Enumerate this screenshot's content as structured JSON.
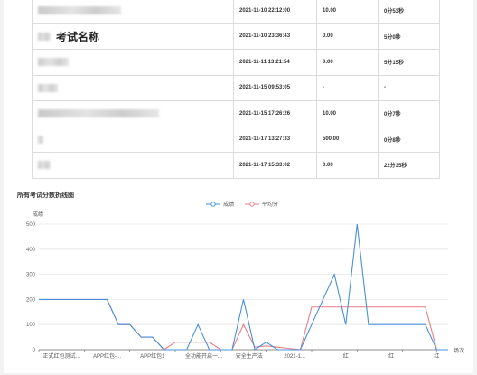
{
  "table": {
    "rows": [
      {
        "name_visible": "",
        "time": "2021-11-10 22:12:00",
        "score": "10.00",
        "duration": "0分53秒"
      },
      {
        "name_visible": "考试名称",
        "time": "2021-11-10 23:36:43",
        "score": "0.00",
        "duration": "5分0秒"
      },
      {
        "name_visible": "",
        "time": "2021-11-11 13:21:54",
        "score": "0.00",
        "duration": "5分15秒"
      },
      {
        "name_visible": "",
        "time": "2021-11-15 09:53:05",
        "score": "-",
        "duration": "-"
      },
      {
        "name_visible": "",
        "time": "2021-11-15 17:26:26",
        "score": "10.00",
        "duration": "0分7秒"
      },
      {
        "name_visible": "",
        "time": "2021-11-17 13:27:33",
        "score": "500.00",
        "duration": "0分8秒"
      },
      {
        "name_visible": "",
        "time": "2021-11-17 15:33:02",
        "score": "0.00",
        "duration": "22分35秒"
      }
    ]
  },
  "chart_section": {
    "title": "所有考试分数折线图"
  },
  "chart_data": {
    "type": "line",
    "ylabel": "成绩",
    "xlabel": "场次",
    "ylim": [
      0,
      500
    ],
    "yticks": [
      0,
      100,
      200,
      300,
      400,
      500
    ],
    "grid": true,
    "legend_position": "top-center",
    "xtick_labels": [
      "正式红包测试...",
      "APP红包-...",
      "APP红包1",
      "全功能开启一...",
      "安全生产法",
      "2021-1...",
      "红",
      "红",
      "红"
    ],
    "series": [
      {
        "name": "成绩",
        "color": "#4a90d9",
        "values": [
          200,
          200,
          200,
          200,
          200,
          200,
          200,
          100,
          100,
          50,
          50,
          0,
          0,
          0,
          100,
          0,
          0,
          0,
          200,
          0,
          30,
          0,
          0,
          0,
          100,
          200,
          300,
          100,
          500,
          100,
          100,
          100,
          100,
          100,
          100,
          0,
          0
        ]
      },
      {
        "name": "平均分",
        "color": "#e57f8a",
        "values": [
          200,
          200,
          200,
          200,
          200,
          200,
          200,
          100,
          100,
          50,
          50,
          0,
          30,
          30,
          30,
          30,
          0,
          0,
          100,
          10,
          15,
          10,
          5,
          0,
          170,
          170,
          170,
          170,
          170,
          170,
          170,
          170,
          170,
          170,
          170,
          0,
          0
        ]
      }
    ],
    "xtick_positions": [
      0,
      4,
      8,
      12,
      16,
      20,
      24,
      28,
      32,
      35
    ]
  }
}
